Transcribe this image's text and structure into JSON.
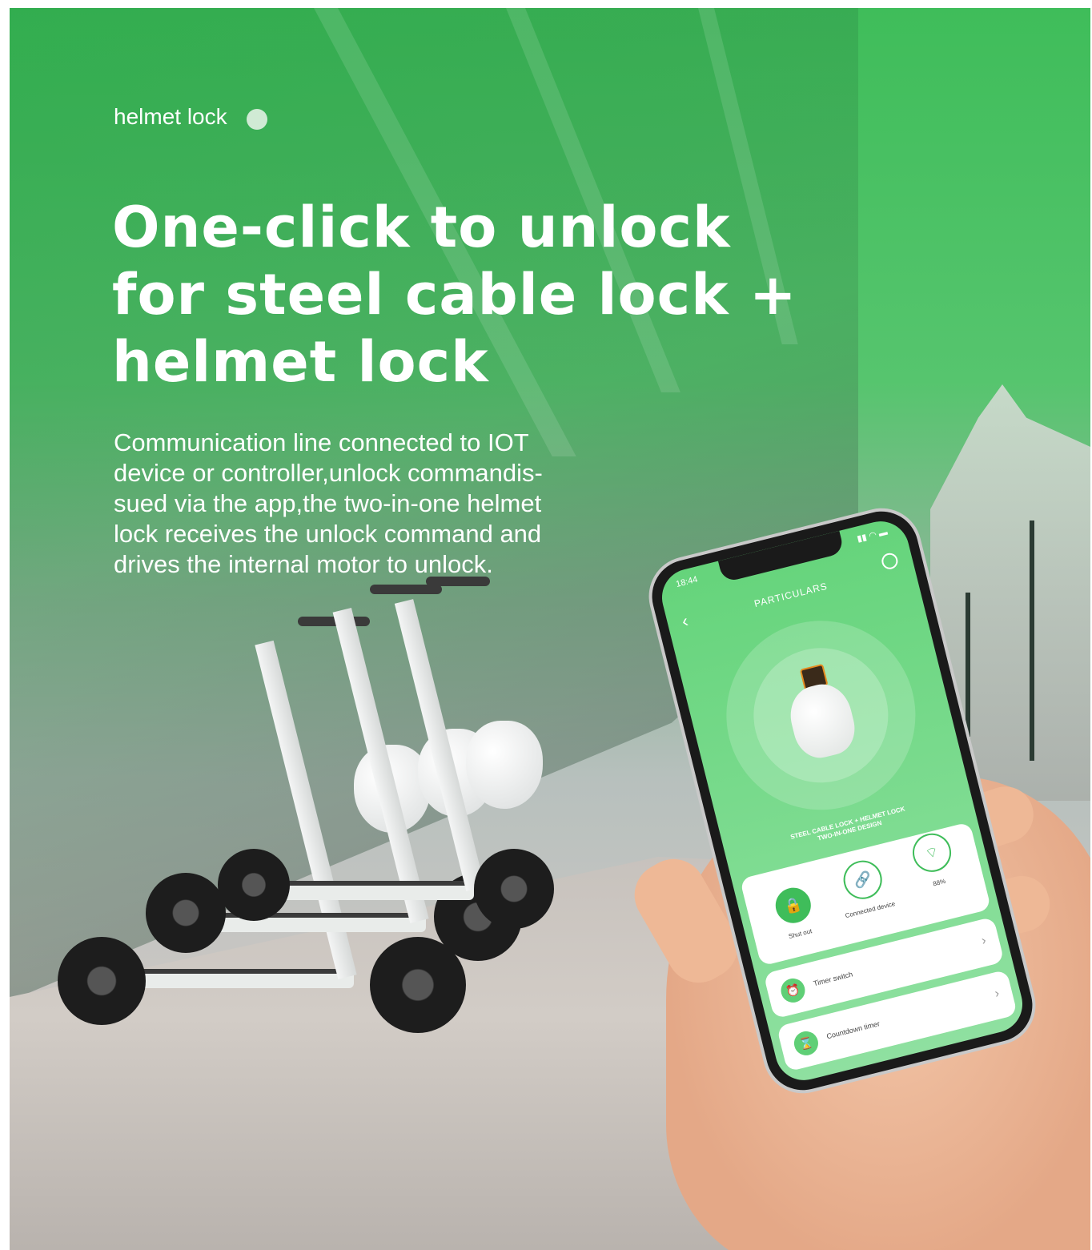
{
  "banner": {
    "tag": "helmet lock",
    "headline_line1": "One-click to unlock",
    "headline_line2": "for steel cable lock +",
    "headline_line3": "helmet lock",
    "desc_line1": "Communication line connected to IOT",
    "desc_line2": "device or controller,unlock commandis-",
    "desc_line3": "sued via the app,the two-in-one helmet",
    "desc_line4": "lock receives the unlock command and",
    "desc_line5": "drives the internal motor to unlock.",
    "accent_color": "#3fbd5a"
  },
  "phone_app": {
    "status_time": "18:44",
    "title": "PARTICULARS",
    "product_caption_line1": "STEEL CABLE LOCK + HELMET LOCK",
    "product_caption_line2": "TWO-IN-ONE DESIGN",
    "stats": [
      {
        "label": "Shut out",
        "icon": "padlock-icon"
      },
      {
        "label": "Connected device",
        "icon": "link-icon"
      },
      {
        "label": "88%",
        "icon": "wifi-icon"
      }
    ],
    "rows": [
      {
        "label": "Timer switch",
        "icon": "alarm-clock-icon"
      },
      {
        "label": "Countdown timer",
        "icon": "hourglass-icon"
      }
    ]
  }
}
